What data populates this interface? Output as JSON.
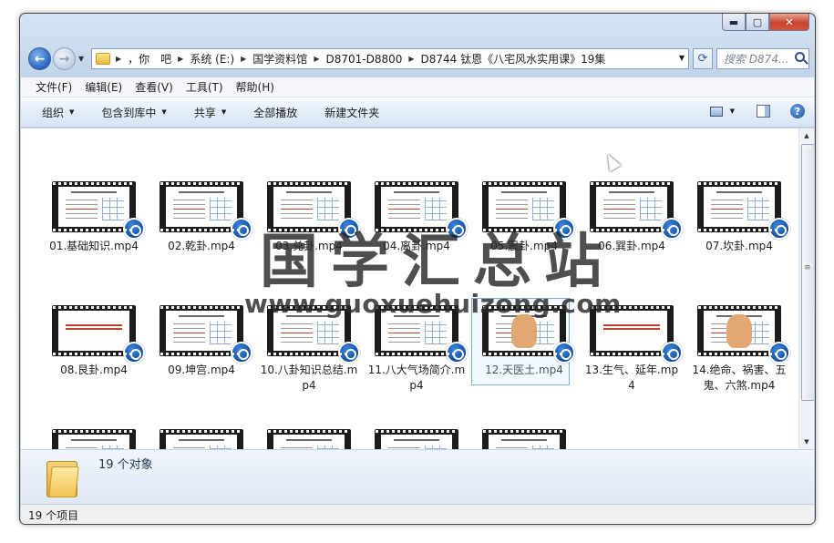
{
  "window": {
    "caption": {
      "minimize": "▬",
      "maximize": "▢",
      "close": "✕"
    }
  },
  "address": {
    "crumbs": [
      "，你　吧",
      "系统 (E:)",
      "国学资料馆",
      "D8701-D8800",
      "D8744 钛恩《八宅风水实用课》19集"
    ],
    "search_placeholder": "搜索 D874..."
  },
  "menu": [
    "文件(F)",
    "编辑(E)",
    "查看(V)",
    "工具(T)",
    "帮助(H)"
  ],
  "toolbar": {
    "organize": "组织",
    "include_library": "包含到库中",
    "share": "共享",
    "play_all": "全部播放",
    "new_folder": "新建文件夹"
  },
  "files": [
    {
      "name": "01.基础知识.mp4",
      "thumb": "slide"
    },
    {
      "name": "02.乾卦.mp4",
      "thumb": "slide"
    },
    {
      "name": "03.兑卦.mp4",
      "thumb": "slide"
    },
    {
      "name": "04.离卦.mp4",
      "thumb": "slide"
    },
    {
      "name": "05.震卦.mp4",
      "thumb": "slide"
    },
    {
      "name": "06.巽卦.mp4",
      "thumb": "slide"
    },
    {
      "name": "07.坎卦.mp4",
      "thumb": "slide"
    },
    {
      "name": "08.艮卦.mp4",
      "thumb": "title"
    },
    {
      "name": "09.坤宫.mp4",
      "thumb": "slide"
    },
    {
      "name": "10.八卦知识总结.mp4",
      "thumb": "slide"
    },
    {
      "name": "11.八大气场简介.mp4",
      "thumb": "slide"
    },
    {
      "name": "12.天医土.mp4",
      "thumb": "hand",
      "selected": true
    },
    {
      "name": "13.生气、延年.mp4",
      "thumb": "title"
    },
    {
      "name": "14.绝命、祸害、五鬼、六煞.mp4",
      "thumb": "hand"
    },
    {
      "name": "",
      "thumb": "slide"
    },
    {
      "name": "",
      "thumb": "slide"
    },
    {
      "name": "",
      "thumb": "slide"
    },
    {
      "name": "",
      "thumb": "photo"
    },
    {
      "name": "",
      "thumb": "photo"
    }
  ],
  "details": {
    "count": "19 个对象"
  },
  "status": {
    "items": "19 个项目"
  },
  "watermark": {
    "cn": "国学汇总站",
    "url": "www.guoxuehuizong.com"
  }
}
